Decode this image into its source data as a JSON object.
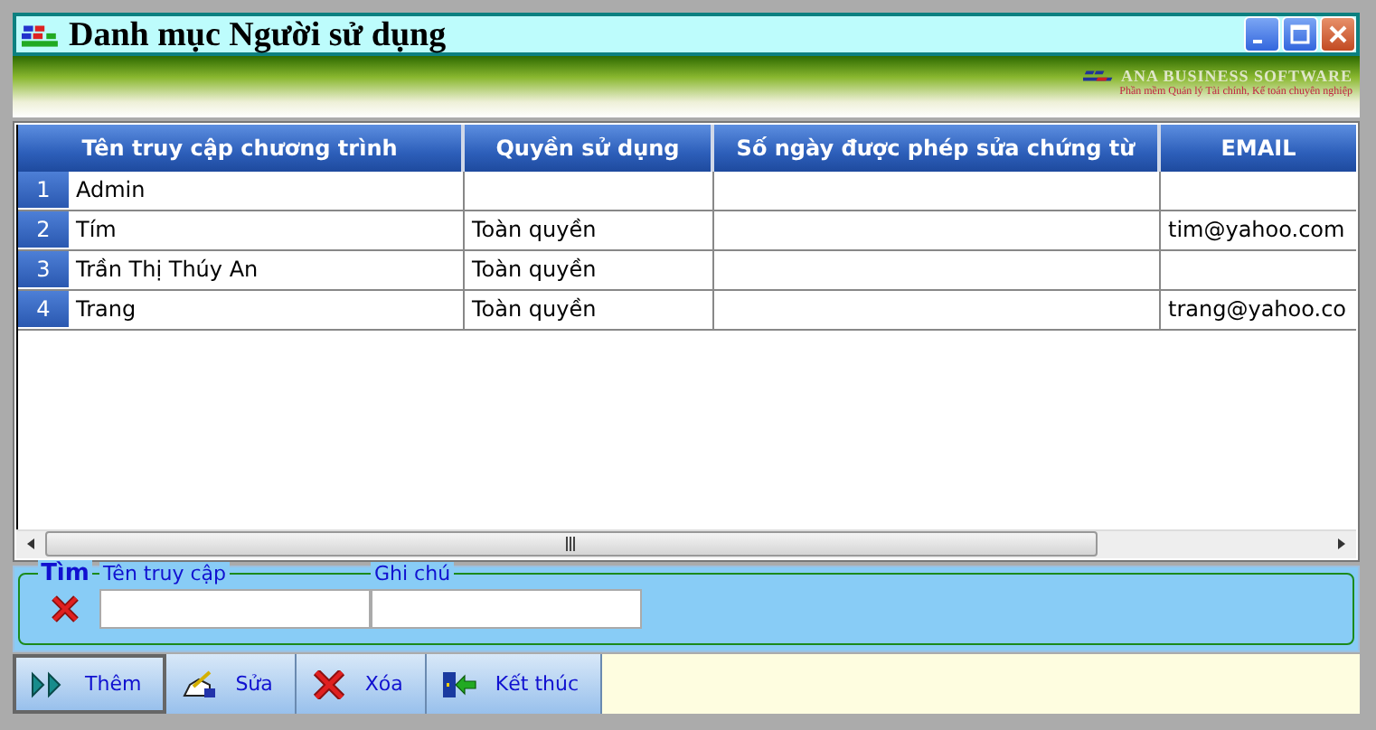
{
  "window": {
    "title": "Danh mục Người sử dụng"
  },
  "banner": {
    "brand": "ANA BUSINESS SOFTWARE",
    "tagline": "Phần mềm Quản lý Tài chính, Kế toán chuyên nghiệp"
  },
  "table": {
    "columns": [
      "Tên truy cập chương trình",
      "Quyền sử dụng",
      "Số ngày được phép sửa chứng từ",
      "EMAIL"
    ],
    "rows": [
      {
        "number": "1",
        "cells": [
          "Admin",
          "",
          "",
          ""
        ]
      },
      {
        "number": "2",
        "cells": [
          "Tím",
          "Toàn quyền",
          "",
          "tim@yahoo.com"
        ]
      },
      {
        "number": "3",
        "cells": [
          "Trần Thị Thúy An",
          "Toàn quyền",
          "",
          ""
        ]
      },
      {
        "number": "4",
        "cells": [
          "Trang",
          "Toàn quyền",
          "",
          "trang@yahoo.co"
        ]
      }
    ]
  },
  "search": {
    "title": "Tìm",
    "fields": [
      {
        "label": "Tên truy cập"
      },
      {
        "label": "Ghi chú"
      }
    ]
  },
  "buttons": [
    {
      "kind": "add",
      "label": "Thêm",
      "selected": true
    },
    {
      "kind": "edit",
      "label": "Sửa",
      "selected": false
    },
    {
      "kind": "delete",
      "label": "Xóa",
      "selected": false
    },
    {
      "kind": "exit",
      "label": "Kết thúc",
      "selected": false
    }
  ]
}
